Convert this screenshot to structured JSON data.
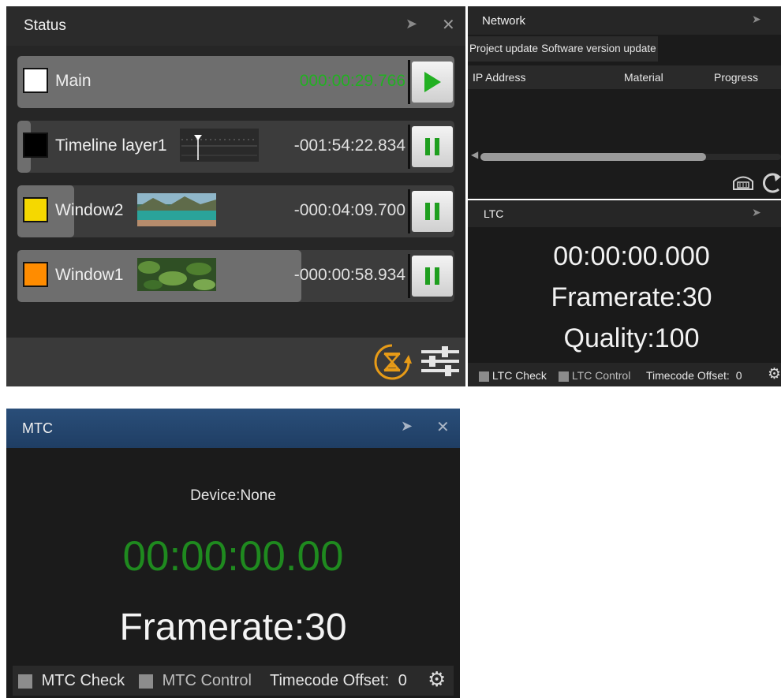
{
  "status_panel": {
    "title": "Status",
    "layers": [
      {
        "name": "Main",
        "time": "000:00:29.766",
        "swatch": "#ffffff",
        "time_color": "#22b022",
        "state": "play",
        "progress": 1.0
      },
      {
        "name": "Timeline layer1",
        "time": "-001:54:22.834",
        "swatch": "#000000",
        "time_color": "#e0e0e0",
        "state": "pause",
        "progress": 0.03
      },
      {
        "name": "Window2",
        "time": "-000:04:09.700",
        "swatch": "#f5d800",
        "time_color": "#e0e0e0",
        "state": "pause",
        "progress": 0.13
      },
      {
        "name": "Window1",
        "time": "-000:00:58.934",
        "swatch": "#ff8c00",
        "time_color": "#e0e0e0",
        "state": "pause",
        "progress": 0.65
      }
    ],
    "footer_icons": [
      "hourglass-refresh-icon",
      "sliders-icon"
    ]
  },
  "network_panel": {
    "title": "Network",
    "tabs": [
      "Project update",
      "Software version update"
    ],
    "columns": [
      "IP Address",
      "Material",
      "Progress"
    ],
    "tool_icons": [
      "network-scan-icon",
      "refresh-icon"
    ]
  },
  "ltc_panel": {
    "title": "LTC",
    "timecode": "00:00:00.000",
    "framerate": "Framerate:30",
    "quality": "Quality:100",
    "ltc_check": "LTC Check",
    "ltc_control": "LTC Control",
    "offset_label": "Timecode Offset:",
    "offset_value": "0"
  },
  "mtc_panel": {
    "title": "MTC",
    "device": "Device:None",
    "timecode": "00:00:00.00",
    "framerate": "Framerate:30",
    "mtc_check": "MTC Check",
    "mtc_control": "MTC Control",
    "offset_label": "Timecode Offset:",
    "offset_value": "0"
  },
  "colors": {
    "play_green": "#22b022",
    "pause_green": "#1e9e1e",
    "mtc_timecode": "#1f8a1f",
    "mtc_titlebar": "#244a76",
    "hourglass": "#e79b17"
  }
}
